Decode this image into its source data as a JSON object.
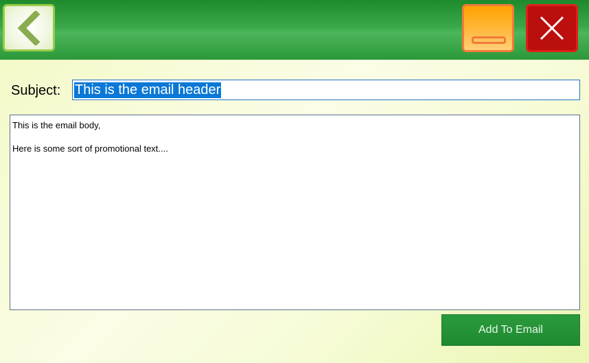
{
  "header": {
    "back_icon": "chevron-left-icon",
    "minimize_icon": "minimize-icon",
    "close_icon": "close-icon",
    "colors": {
      "bar": "#2a9838",
      "back_border": "#9acb4a",
      "back_glyph": "#8aab4e",
      "minimize_fill": "#ffa200",
      "minimize_border": "#f07a3a",
      "close_fill": "#bb0f0d",
      "close_border": "#e0201a"
    }
  },
  "form": {
    "subject_label": "Subject:",
    "subject_value": "This is the email header",
    "body_lines": [
      "This is the email body,",
      "Here is some sort of promotional text...."
    ],
    "add_button_label": "Add To Email"
  },
  "colors": {
    "selection": "#0a78d6",
    "input_border": "#2273c8",
    "button_green": "#1f8a30"
  }
}
